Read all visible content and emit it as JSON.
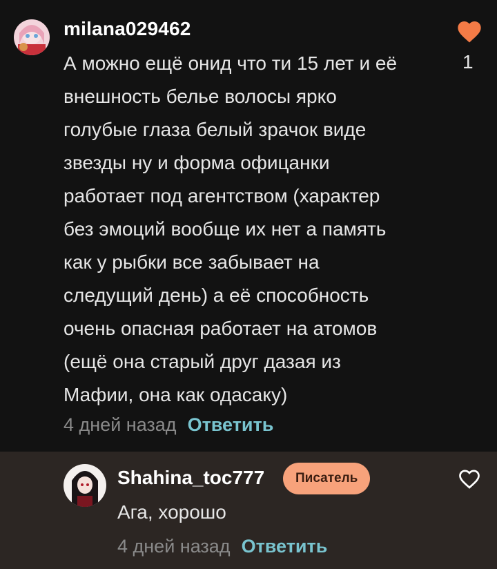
{
  "comment": {
    "username": "milana029462",
    "text": "А можно ещё онид что ти 15 лет и её\nвнешность белье волосы ярко\nголубые глаза белый зрачок виде\nзвезды ну и форма офицанки\nработает под агентством (характер\nбез эмоций вообще их нет а память\nкак у рыбки все забывает на\nследущий день) а её способность\nочень опасная работает на атомов\n(ещё она старый друг дазая из\nМафии, она как одасаку)",
    "time": "4 дней назад",
    "reply_label": "Ответить",
    "like_count": "1",
    "liked": true,
    "heart_color": "#f47b46"
  },
  "reply": {
    "username": "Shahina_toc777",
    "badge": "Писатель",
    "text": "Ага, хорошо",
    "time": "4 дней назад",
    "reply_label": "Ответить",
    "liked": false
  },
  "colors": {
    "background": "#121212",
    "reply_background": "#2c2623",
    "accent_reply": "#79c4cf",
    "badge": "#f7a27b"
  }
}
